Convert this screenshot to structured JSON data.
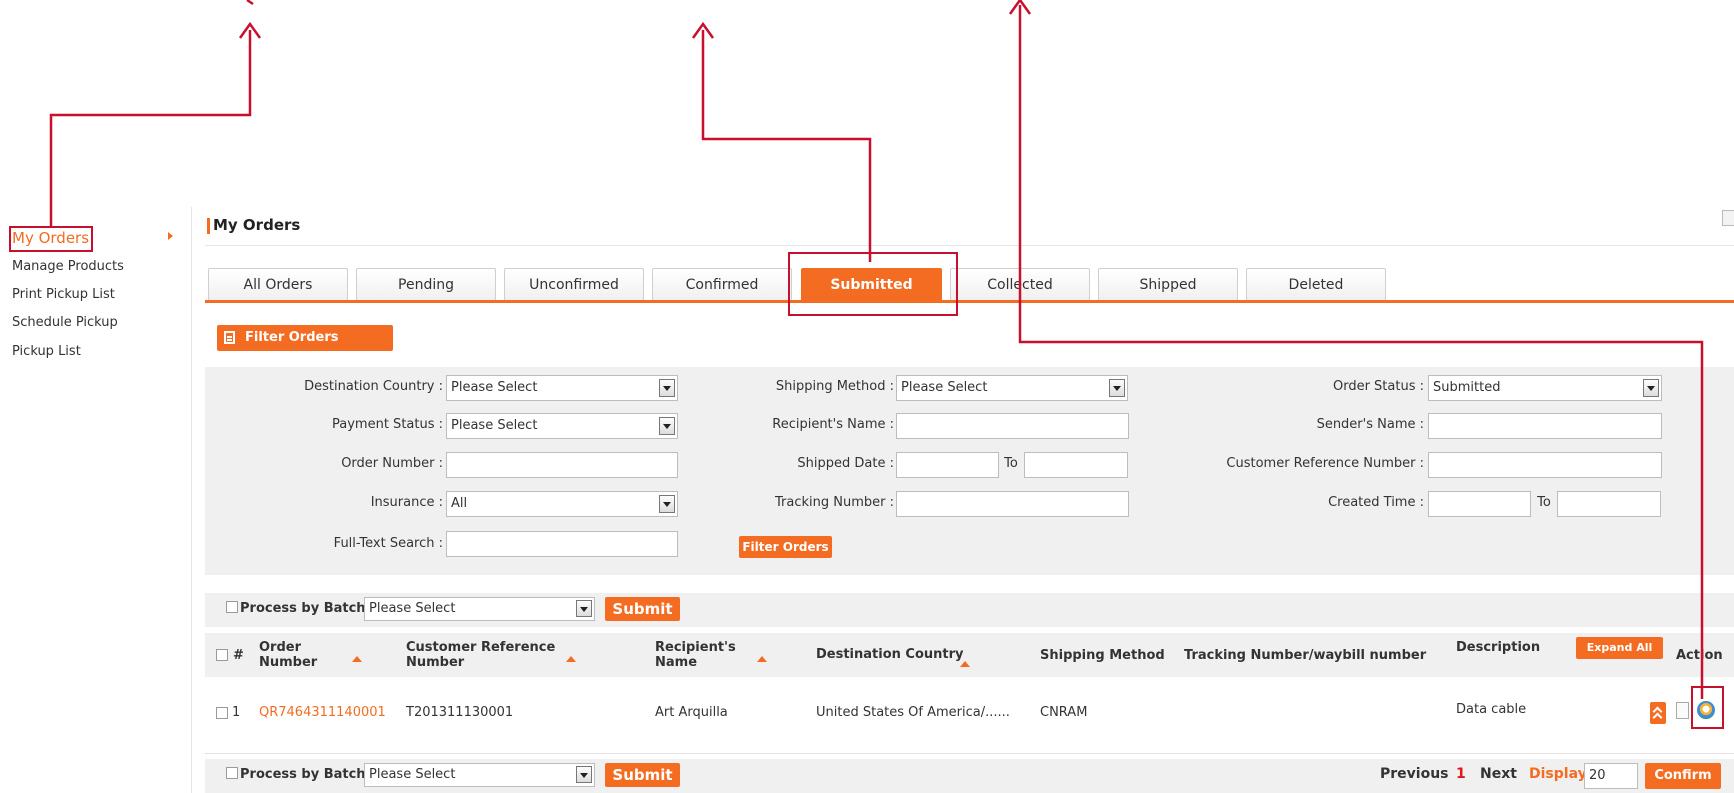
{
  "sidebar": {
    "items": [
      {
        "label": "My Orders"
      },
      {
        "label": "Manage Products"
      },
      {
        "label": "Print Pickup List"
      },
      {
        "label": "Schedule Pickup"
      },
      {
        "label": "Pickup List"
      }
    ]
  },
  "header": {
    "title": "My Orders"
  },
  "tabs": [
    {
      "label": "All Orders"
    },
    {
      "label": "Pending"
    },
    {
      "label": "Unconfirmed"
    },
    {
      "label": "Confirmed"
    },
    {
      "label": "Submitted",
      "active": true
    },
    {
      "label": "Collected"
    },
    {
      "label": "Shipped"
    },
    {
      "label": "Deleted"
    }
  ],
  "filter": {
    "toggle_label": "Filter Orders",
    "destination_country": {
      "label": "Destination Country :",
      "value": "Please Select"
    },
    "payment_status": {
      "label": "Payment Status :",
      "value": "Please Select"
    },
    "order_number": {
      "label": "Order Number :",
      "value": ""
    },
    "insurance": {
      "label": "Insurance :",
      "value": "All"
    },
    "full_text_search": {
      "label": "Full-Text Search :",
      "value": ""
    },
    "shipping_method": {
      "label": "Shipping Method :",
      "value": "Please Select"
    },
    "recipient_name": {
      "label": "Recipient's Name :",
      "value": ""
    },
    "shipped_date": {
      "label": "Shipped Date :",
      "to_label": "To",
      "from": "",
      "to": ""
    },
    "tracking_number": {
      "label": "Tracking Number :",
      "value": ""
    },
    "order_status": {
      "label": "Order Status :",
      "value": "Submitted"
    },
    "sender_name": {
      "label": "Sender's Name :",
      "value": ""
    },
    "customer_reference": {
      "label": "Customer Reference Number :",
      "value": ""
    },
    "created_time": {
      "label": "Created Time :",
      "to_label": "To",
      "from": "",
      "to": ""
    },
    "submit_label": "Filter Orders"
  },
  "batch": {
    "label": "Process by Batch",
    "select_value": "Please Select",
    "submit_label": "Submit"
  },
  "table": {
    "headers": {
      "hash": "#",
      "order_number": [
        "Order",
        "Number"
      ],
      "customer_ref": [
        "Customer Reference",
        "Number"
      ],
      "recipient": [
        "Recipient's",
        "Name"
      ],
      "destination": "Destination Country",
      "shipping": "Shipping Method",
      "tracking": "Tracking Number/waybill number",
      "description": "Description",
      "expand_all": "Expand All",
      "action": "Action"
    },
    "rows": [
      {
        "index": "1",
        "order_number": "QR7464311140001",
        "customer_ref": "T201311130001",
        "recipient": "Art Arquilla",
        "destination": "United States Of America/......",
        "shipping": "CNRAM",
        "tracking": "",
        "description": "Data cable"
      }
    ]
  },
  "pagination": {
    "previous": "Previous",
    "current": "1",
    "next": "Next",
    "display_label": "Display",
    "display_value": "20",
    "confirm_label": "Confirm"
  },
  "colors": {
    "accent": "#f36c21",
    "annotation": "#c8102e"
  }
}
